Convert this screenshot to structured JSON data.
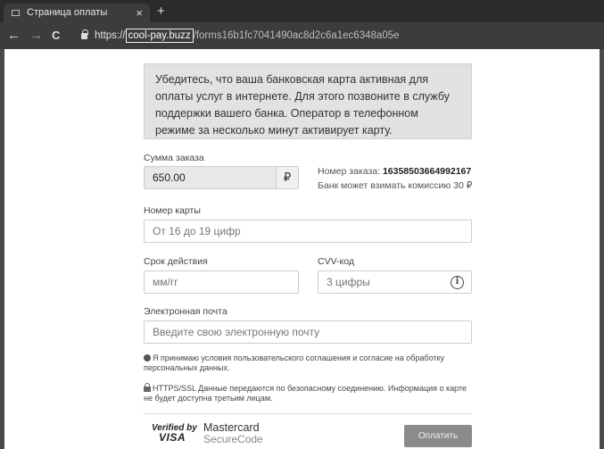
{
  "browser": {
    "tab_title": "Страница оплаты",
    "tab_close": "×",
    "new_tab": "+",
    "back": "←",
    "forward": "→",
    "reload": "C",
    "url_scheme": "https://",
    "url_host": "cool-pay.buzz",
    "url_path": "/forms16b1fc7041490ac8d2c6a1ec6348a05e"
  },
  "notice": "Убедитесь, что ваша банковская карта активная для оплаты услуг в интернете. Для этого позвоните в службу поддержки вашего банка. Оператор в телефонном режиме за несколько минут активирует карту.",
  "order": {
    "amount_label": "Сумма заказа",
    "amount_value": "650.00",
    "currency": "₽",
    "order_number_label": "Номер заказа:",
    "order_number": "16358503664992167",
    "commission": "Банк может взимать комиссию 30 ₽"
  },
  "form": {
    "card_label": "Номер карты",
    "card_placeholder": "От 16 до 19 цифр",
    "expiry_label": "Срок действия",
    "expiry_placeholder": "мм/гг",
    "cvv_label": "CVV-код",
    "cvv_placeholder": "3 цифры",
    "cvv_info": "i",
    "email_label": "Электронная почта",
    "email_placeholder": "Введите свою электронную почту"
  },
  "agreement": "Я принимаю условия пользовательского соглашения и согласие на обработку персональных данных.",
  "ssl_note": "HTTPS/SSL Данные передаются по безопасному соединению. Информация о карте не будет доступна третьим лицам.",
  "footer": {
    "verified_by": "Verified by",
    "visa": "VISA",
    "mastercard": "Mastercard",
    "securecode": "SecureCode",
    "pay_button": "Оплатить"
  }
}
